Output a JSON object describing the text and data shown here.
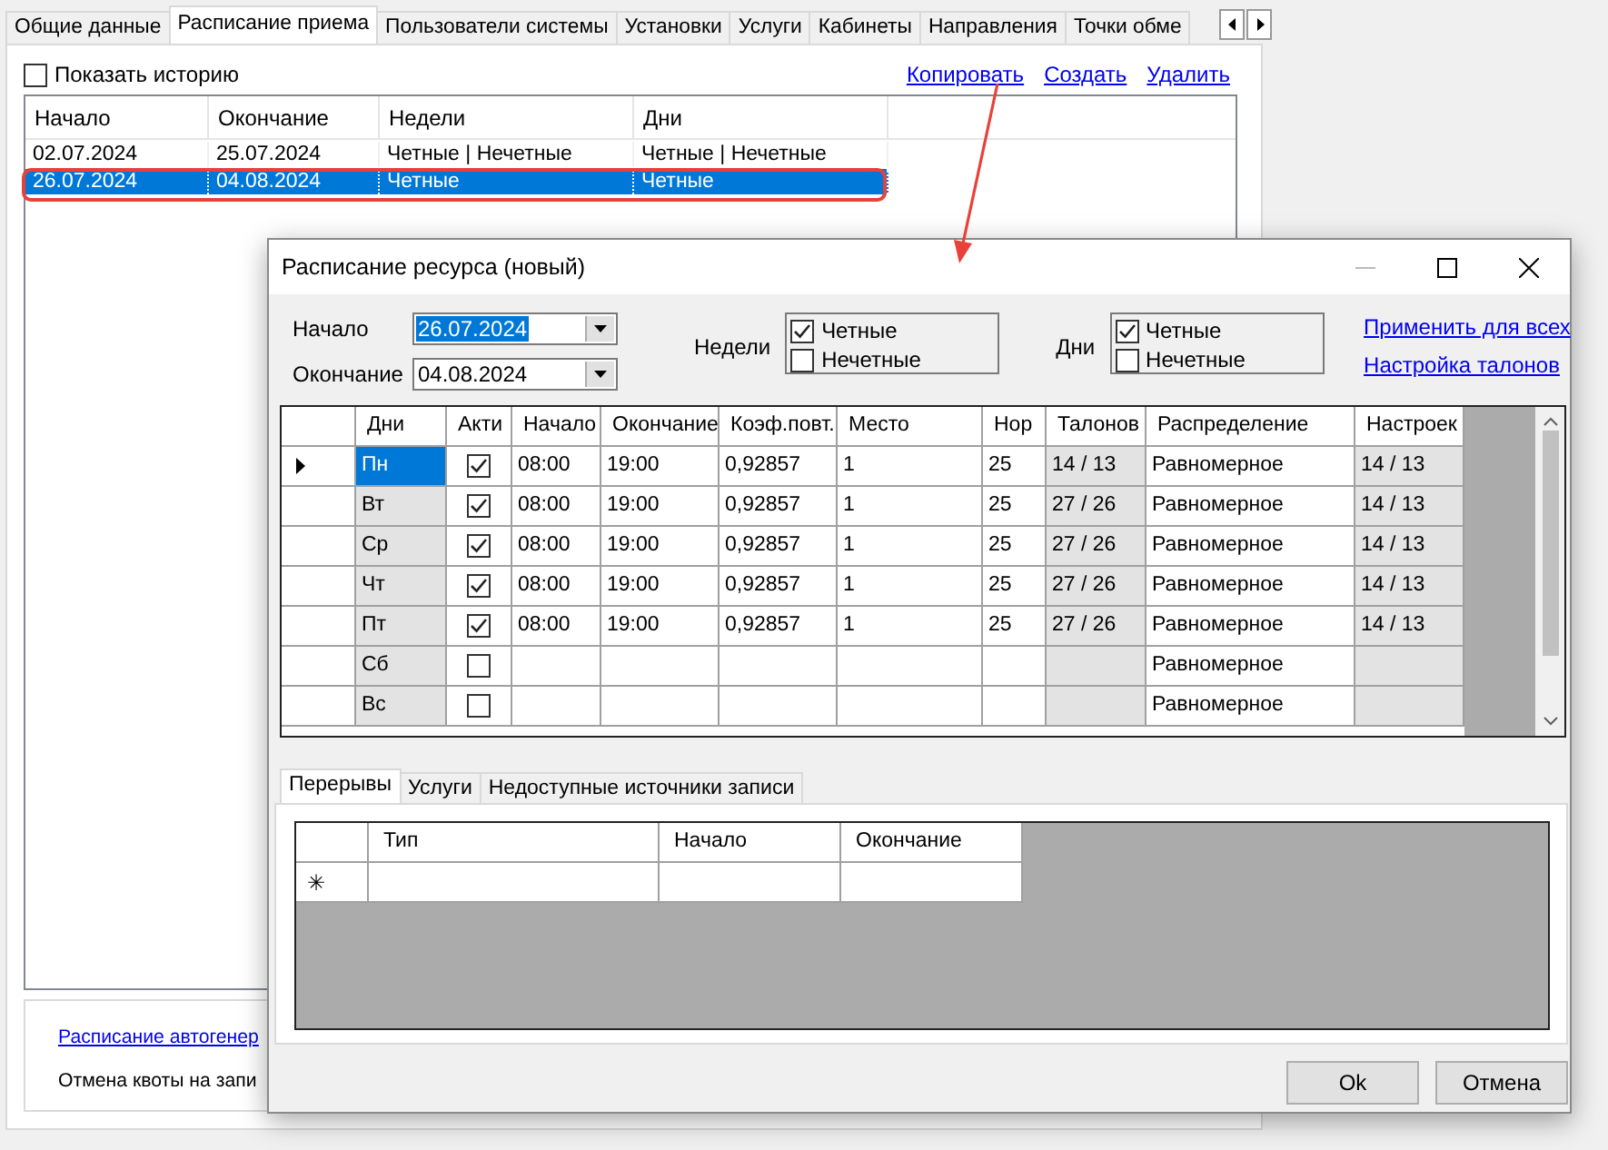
{
  "main_tabs": [
    {
      "label": "Общие данные",
      "selected": false
    },
    {
      "label": "Расписание приема",
      "selected": true
    },
    {
      "label": "Пользователи системы",
      "selected": false
    },
    {
      "label": "Установки",
      "selected": false
    },
    {
      "label": "Услуги",
      "selected": false
    },
    {
      "label": "Кабинеты",
      "selected": false
    },
    {
      "label": "Направления",
      "selected": false
    },
    {
      "label": "Точки обме",
      "selected": false
    }
  ],
  "history": {
    "label": "Показать историю",
    "checked": false
  },
  "actions": [
    "Копировать",
    "Создать",
    "Удалить"
  ],
  "schedules": {
    "columns": [
      "Начало",
      "Окончание",
      "Недели",
      "Дни"
    ],
    "rows": [
      {
        "selected": false,
        "cells": [
          "02.07.2024",
          "25.07.2024",
          "Четные | Нечетные",
          "Четные | Нечетные"
        ]
      },
      {
        "selected": true,
        "cells": [
          "26.07.2024",
          "04.08.2024",
          "Четные",
          "Четные"
        ]
      }
    ]
  },
  "bottom_items": [
    {
      "kind": "link",
      "text": "Расписание автогенер"
    },
    {
      "kind": "text",
      "text": "Отмена квоты на запи"
    }
  ],
  "dialog": {
    "title": "Расписание ресурса (новый)",
    "start": {
      "label": "Начало",
      "value": "26.07.2024",
      "highlighted": true
    },
    "end": {
      "label": "Окончание",
      "value": "04.08.2024",
      "highlighted": false
    },
    "weeks": {
      "label": "Недели",
      "options": [
        {
          "label": "Четные",
          "checked": true
        },
        {
          "label": "Нечетные",
          "checked": false
        }
      ]
    },
    "days": {
      "label": "Дни",
      "options": [
        {
          "label": "Четные",
          "checked": true
        },
        {
          "label": "Нечетные",
          "checked": false
        }
      ]
    },
    "links": [
      "Применить для всех",
      "Настройка талонов"
    ],
    "grid": {
      "columns": [
        {
          "label": "Дни",
          "kind": "text",
          "readonly": true
        },
        {
          "label": "Акти",
          "kind": "check",
          "readonly": false
        },
        {
          "label": "Начало",
          "kind": "text",
          "readonly": false
        },
        {
          "label": "Окончание",
          "kind": "text",
          "readonly": false
        },
        {
          "label": "Коэф.повт.",
          "kind": "text",
          "readonly": false
        },
        {
          "label": "Место",
          "kind": "text",
          "readonly": false
        },
        {
          "label": "Нор",
          "kind": "text",
          "readonly": false
        },
        {
          "label": "Талонов",
          "kind": "text",
          "readonly": true
        },
        {
          "label": "Распределение",
          "kind": "text",
          "readonly": false
        },
        {
          "label": "Настроек",
          "kind": "text",
          "readonly": true
        }
      ],
      "rows": [
        {
          "selected": true,
          "day": "Пн",
          "active": true,
          "start": "08:00",
          "end": "19:00",
          "coef": "0,92857",
          "place": "1",
          "norm": "25",
          "tickets": "14 / 13",
          "distribution": "Равномерное",
          "settings": "14 / 13"
        },
        {
          "selected": false,
          "day": "Вт",
          "active": true,
          "start": "08:00",
          "end": "19:00",
          "coef": "0,92857",
          "place": "1",
          "norm": "25",
          "tickets": "27 / 26",
          "distribution": "Равномерное",
          "settings": "14 / 13"
        },
        {
          "selected": false,
          "day": "Ср",
          "active": true,
          "start": "08:00",
          "end": "19:00",
          "coef": "0,92857",
          "place": "1",
          "norm": "25",
          "tickets": "27 / 26",
          "distribution": "Равномерное",
          "settings": "14 / 13"
        },
        {
          "selected": false,
          "day": "Чт",
          "active": true,
          "start": "08:00",
          "end": "19:00",
          "coef": "0,92857",
          "place": "1",
          "norm": "25",
          "tickets": "27 / 26",
          "distribution": "Равномерное",
          "settings": "14 / 13"
        },
        {
          "selected": false,
          "day": "Пт",
          "active": true,
          "start": "08:00",
          "end": "19:00",
          "coef": "0,92857",
          "place": "1",
          "norm": "25",
          "tickets": "27 / 26",
          "distribution": "Равномерное",
          "settings": "14 / 13"
        },
        {
          "selected": false,
          "day": "Сб",
          "active": false,
          "distribution": "Равномерное"
        },
        {
          "selected": false,
          "day": "Вс",
          "active": false,
          "distribution": "Равномерное"
        }
      ]
    },
    "subtabs": [
      {
        "label": "Перерывы",
        "selected": true
      },
      {
        "label": "Услуги",
        "selected": false
      },
      {
        "label": "Недоступные источники записи",
        "selected": false
      }
    ],
    "breaks": {
      "columns": [
        "Тип",
        "Начало",
        "Окончание"
      ],
      "new_row_mark": "✳"
    },
    "buttons": [
      "Ok",
      "Отмена"
    ]
  },
  "annotations": [
    {
      "kind": "highlight"
    },
    {
      "kind": "arrow"
    }
  ]
}
